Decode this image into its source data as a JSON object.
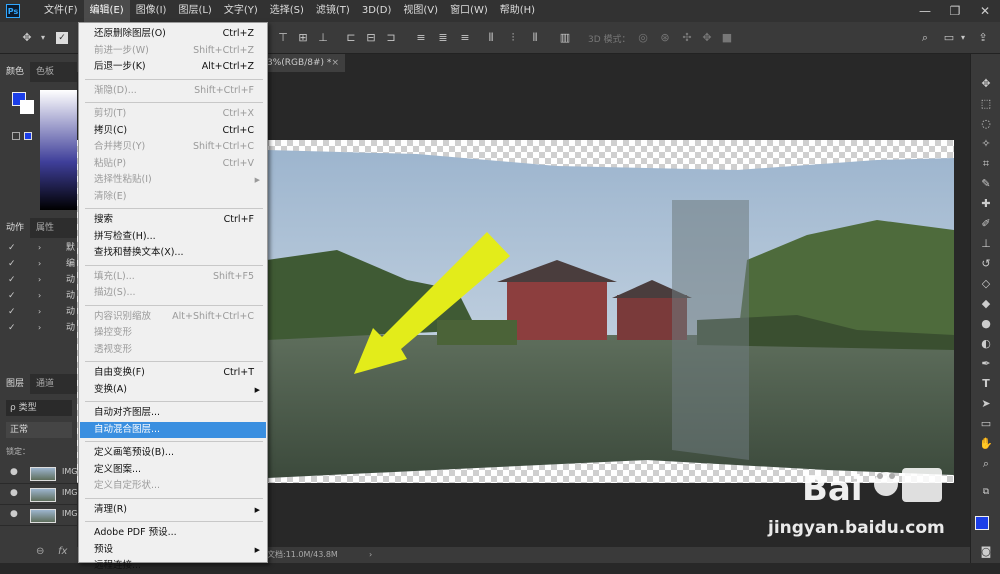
{
  "app": {
    "logo": "Ps"
  },
  "menubar": {
    "items": [
      "文件(F)",
      "编辑(E)",
      "图像(I)",
      "图层(L)",
      "文字(Y)",
      "选择(S)",
      "滤镜(T)",
      "3D(D)",
      "视图(V)",
      "窗口(W)",
      "帮助(H)"
    ],
    "active_index": 1
  },
  "window_controls": {
    "minimize": "—",
    "restore": "❐",
    "close": "✕"
  },
  "options_bar": {
    "mode_3d_label": "3D 模式："
  },
  "document_tab": {
    "title": "3%(RGB/8#) *",
    "close": "×"
  },
  "left_panels": {
    "color_tabs": [
      "颜色",
      "色板"
    ],
    "actions_tabs": [
      "动作",
      "属性"
    ],
    "actions_items": [
      "默",
      "编",
      "动",
      "动",
      "动",
      "动"
    ],
    "layers_tabs": [
      "图层",
      "通道"
    ],
    "layer_filter": "ρ 类型",
    "blend_mode": "正常",
    "lock_label": "锁定：",
    "layers": [
      "IMG",
      "IMG",
      "IMG"
    ],
    "bottom_icons": [
      "link-icon",
      "fx-icon"
    ],
    "fx_text": "fx",
    "link_text": "⊖"
  },
  "status_bar": {
    "doc_info": "文档:11.0M/43.8M",
    "arrow": "›"
  },
  "edit_menu": {
    "items": [
      {
        "label": "还原删除图层(O)",
        "shortcut": "Ctrl+Z",
        "disabled": false
      },
      {
        "label": "前进一步(W)",
        "shortcut": "Shift+Ctrl+Z",
        "disabled": true
      },
      {
        "label": "后退一步(K)",
        "shortcut": "Alt+Ctrl+Z",
        "disabled": false
      },
      {
        "label": "渐隐(D)...",
        "shortcut": "Shift+Ctrl+F",
        "disabled": true
      },
      {
        "label": "剪切(T)",
        "shortcut": "Ctrl+X",
        "disabled": true
      },
      {
        "label": "拷贝(C)",
        "shortcut": "Ctrl+C",
        "disabled": false
      },
      {
        "label": "合并拷贝(Y)",
        "shortcut": "Shift+Ctrl+C",
        "disabled": true
      },
      {
        "label": "粘贴(P)",
        "shortcut": "Ctrl+V",
        "disabled": true
      },
      {
        "label": "选择性粘贴(I)",
        "shortcut": "",
        "disabled": true,
        "submenu": true
      },
      {
        "label": "清除(E)",
        "shortcut": "",
        "disabled": true
      },
      {
        "label": "搜索",
        "shortcut": "Ctrl+F",
        "disabled": false
      },
      {
        "label": "拼写检查(H)...",
        "shortcut": "",
        "disabled": false
      },
      {
        "label": "查找和替换文本(X)...",
        "shortcut": "",
        "disabled": false
      },
      {
        "label": "填充(L)...",
        "shortcut": "Shift+F5",
        "disabled": true
      },
      {
        "label": "描边(S)...",
        "shortcut": "",
        "disabled": true
      },
      {
        "label": "内容识别缩放",
        "shortcut": "Alt+Shift+Ctrl+C",
        "disabled": true
      },
      {
        "label": "操控变形",
        "shortcut": "",
        "disabled": true
      },
      {
        "label": "透视变形",
        "shortcut": "",
        "disabled": true
      },
      {
        "label": "自由变换(F)",
        "shortcut": "Ctrl+T",
        "disabled": false
      },
      {
        "label": "变换(A)",
        "shortcut": "",
        "disabled": false,
        "submenu": true
      },
      {
        "label": "自动对齐图层...",
        "shortcut": "",
        "disabled": false
      },
      {
        "label": "自动混合图层...",
        "shortcut": "",
        "disabled": false,
        "highlighted": true
      },
      {
        "label": "定义画笔预设(B)...",
        "shortcut": "",
        "disabled": false
      },
      {
        "label": "定义图案...",
        "shortcut": "",
        "disabled": false
      },
      {
        "label": "定义自定形状...",
        "shortcut": "",
        "disabled": true
      },
      {
        "label": "清理(R)",
        "shortcut": "",
        "disabled": false,
        "submenu": true
      },
      {
        "label": "Adobe PDF 预设...",
        "shortcut": "",
        "disabled": false
      },
      {
        "label": "预设",
        "shortcut": "",
        "disabled": false,
        "submenu": true
      },
      {
        "label": "远程连接...",
        "shortcut": "",
        "disabled": false
      }
    ],
    "submenu_arrow": "▶"
  },
  "watermark": {
    "site": "jingyan.baidu.com"
  },
  "colors": {
    "foreground": "#1b3ee8",
    "background": "#ffffff",
    "arrow": "#e3ec1a",
    "highlight": "#3a8fe0"
  }
}
